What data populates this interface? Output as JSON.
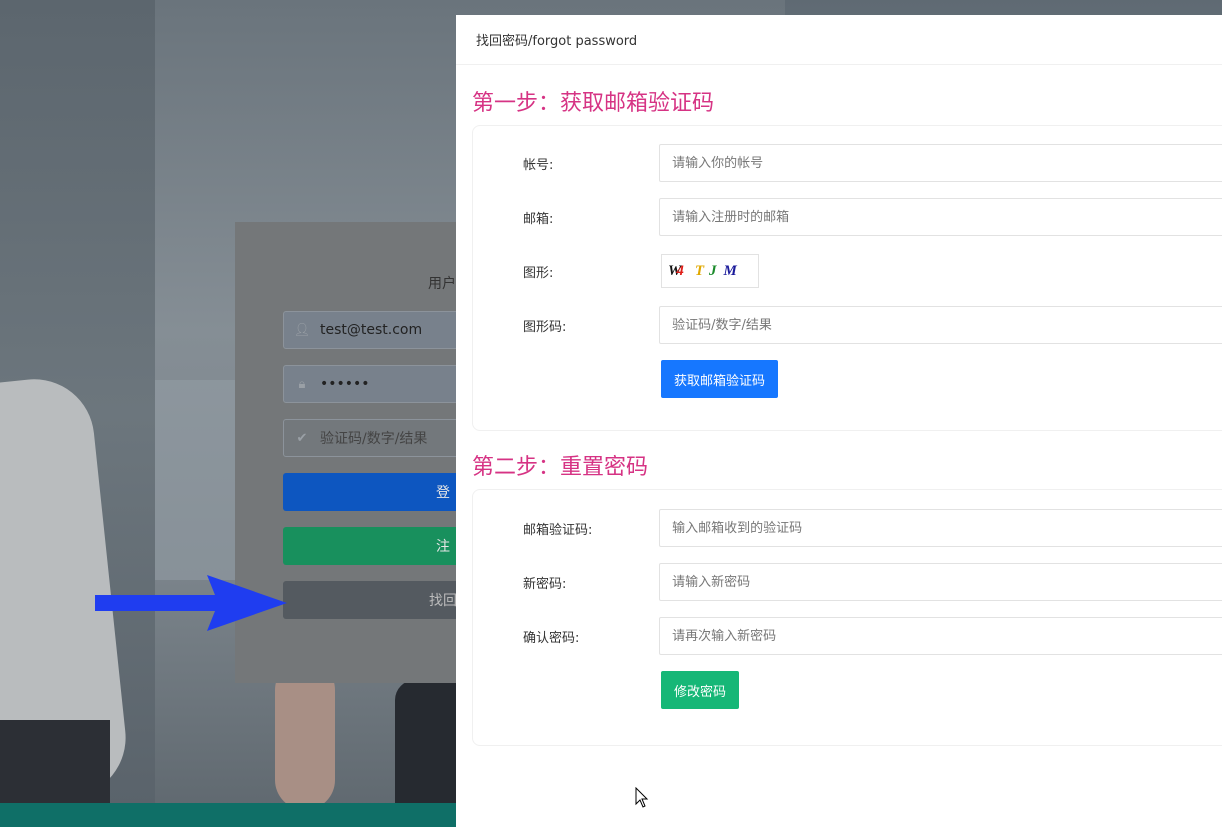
{
  "login": {
    "title": "用户",
    "email_value": "test@test.com",
    "password_value": "••••••",
    "captcha_placeholder": "验证码/数字/结果",
    "login_label": "登",
    "register_label": "注",
    "forgot_label": "找回"
  },
  "modal": {
    "title": "找回密码/forgot password",
    "step1": {
      "heading": "第一步：获取邮箱验证码",
      "account_label": "帐号:",
      "account_placeholder": "请输入你的帐号",
      "email_label": "邮箱:",
      "email_placeholder": "请输入注册时的邮箱",
      "graphic_label": "图形:",
      "captcha_chars": [
        "W",
        "4",
        "T",
        "J",
        "M"
      ],
      "captcha_colors": [
        "#111111",
        "#e0201a",
        "#e0a800",
        "#1a8a2a",
        "#1a1a9a"
      ],
      "graphic_code_label": "图形码:",
      "graphic_code_placeholder": "验证码/数字/结果",
      "button_label": "获取邮箱验证码"
    },
    "step2": {
      "heading": "第二步：重置密码",
      "email_code_label": "邮箱验证码:",
      "email_code_placeholder": "输入邮箱收到的验证码",
      "new_password_label": "新密码:",
      "new_password_placeholder": "请输入新密码",
      "confirm_password_label": "确认密码:",
      "confirm_password_placeholder": "请再次输入新密码",
      "button_label": "修改密码"
    }
  },
  "colors": {
    "step_heading": "#d63384",
    "primary_button": "#1677ff",
    "success_button": "#16b777",
    "arrow": "#1f3df0"
  }
}
